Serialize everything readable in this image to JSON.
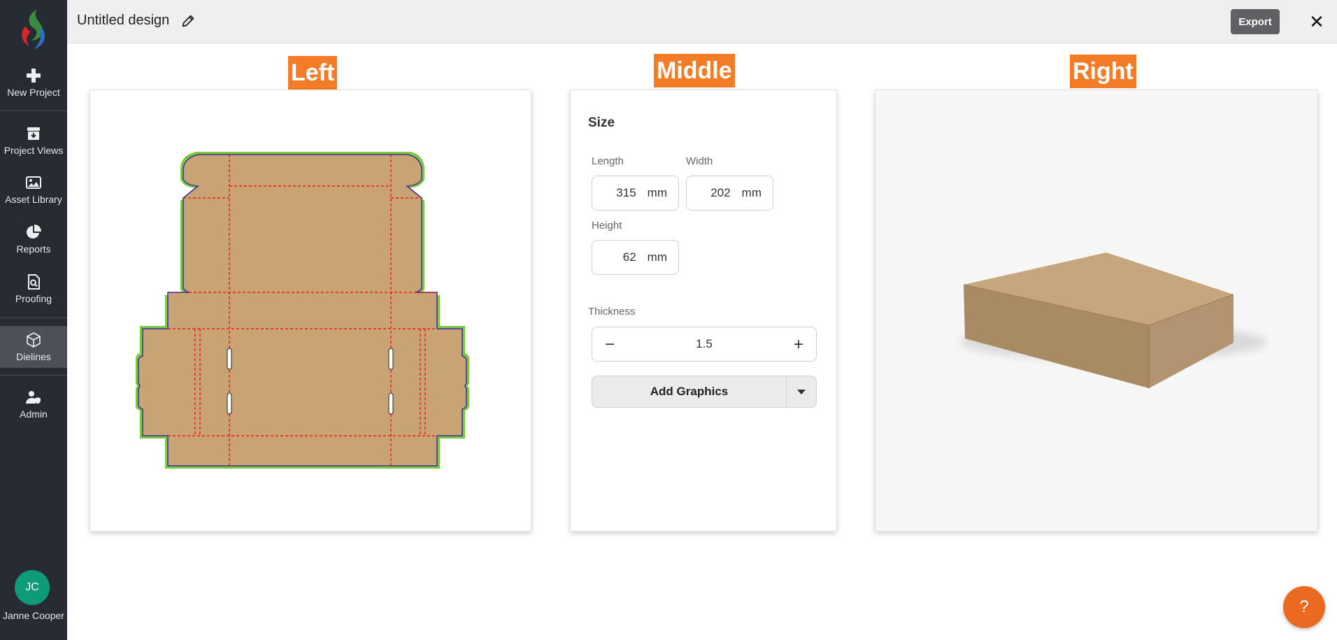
{
  "sidebar": {
    "items": [
      {
        "label": "New Project",
        "icon": "plus-icon"
      },
      {
        "label": "Project Views",
        "icon": "archive-box-icon"
      },
      {
        "label": "Asset Library",
        "icon": "image-icon"
      },
      {
        "label": "Reports",
        "icon": "pie-chart-icon"
      },
      {
        "label": "Proofing",
        "icon": "document-search-icon"
      },
      {
        "label": "Dielines",
        "icon": "box-icon",
        "active": true
      },
      {
        "label": "Admin",
        "icon": "user-shield-icon"
      }
    ],
    "user": {
      "initials": "JC",
      "name": "Janne Cooper"
    }
  },
  "header": {
    "title": "Untitled design",
    "export_label": "Export",
    "close_label": "✕"
  },
  "panels": {
    "left_label": "Left",
    "middle_label": "Middle",
    "right_label": "Right"
  },
  "size": {
    "heading": "Size",
    "length_label": "Length",
    "length_value": "315",
    "width_label": "Width",
    "width_value": "202",
    "height_label": "Height",
    "height_value": "62",
    "unit": "mm",
    "thickness_label": "Thickness",
    "thickness_value": "1.5",
    "minus": "−",
    "plus": "+",
    "add_graphics_label": "Add Graphics"
  },
  "help_label": "?",
  "colors": {
    "sidebar": "#262b31",
    "accent_orange": "#f57c26",
    "cardboard": "#c8a373",
    "cut_line": "#3d2d9b",
    "bleed_line": "#7ac943",
    "fold_line": "#ff0000"
  }
}
